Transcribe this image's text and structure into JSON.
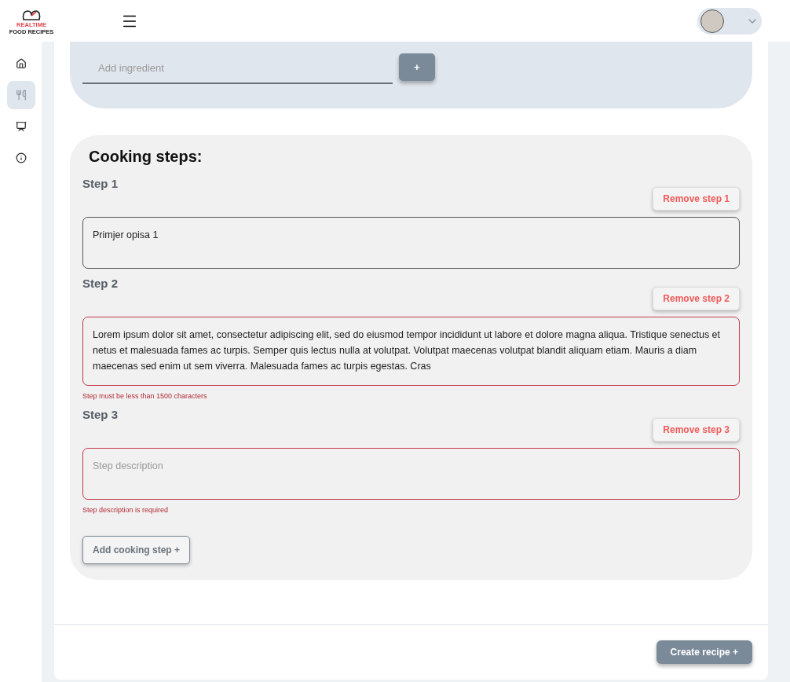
{
  "header": {
    "logo_line_1": "REALTIME",
    "logo_line_2": "FOOD RECIPES"
  },
  "sidebar": {
    "items": [
      {
        "kind": "home",
        "selected": false
      },
      {
        "kind": "recipes",
        "selected": true
      },
      {
        "kind": "presentation",
        "selected": false
      },
      {
        "kind": "info",
        "selected": false
      }
    ]
  },
  "ingredients": {
    "placeholder": "Add ingredient",
    "add_button": "+"
  },
  "cooking_steps": {
    "title": "Cooking steps:",
    "steps": [
      {
        "label": "Step 1",
        "remove_button": "Remove step 1",
        "value": "Primjer opisa 1",
        "invalid": false
      },
      {
        "label": "Step 2",
        "remove_button": "Remove step 2",
        "value": "Lorem ipsum dolor sit amet, consectetur adipiscing elit, sed do eiusmod tempor incididunt ut labore et dolore magna aliqua. Tristique senectus et netus et malesuada fames ac turpis. Semper quis lectus nulla at volutpat. Volutpat maecenas volutpat blandit aliquam etiam. Mauris a diam maecenas sed enim ut sem viverra. Malesuada fames ac turpis egestas. Cras",
        "invalid": true,
        "error": "Step must be less than 1500 characters"
      },
      {
        "label": "Step 3",
        "remove_button": "Remove step 3",
        "placeholder": "Step description",
        "invalid": true,
        "error": "Step description is required"
      }
    ],
    "add_button": "Add cooking step +"
  },
  "footer": {
    "create_button": "Create recipe +"
  }
}
